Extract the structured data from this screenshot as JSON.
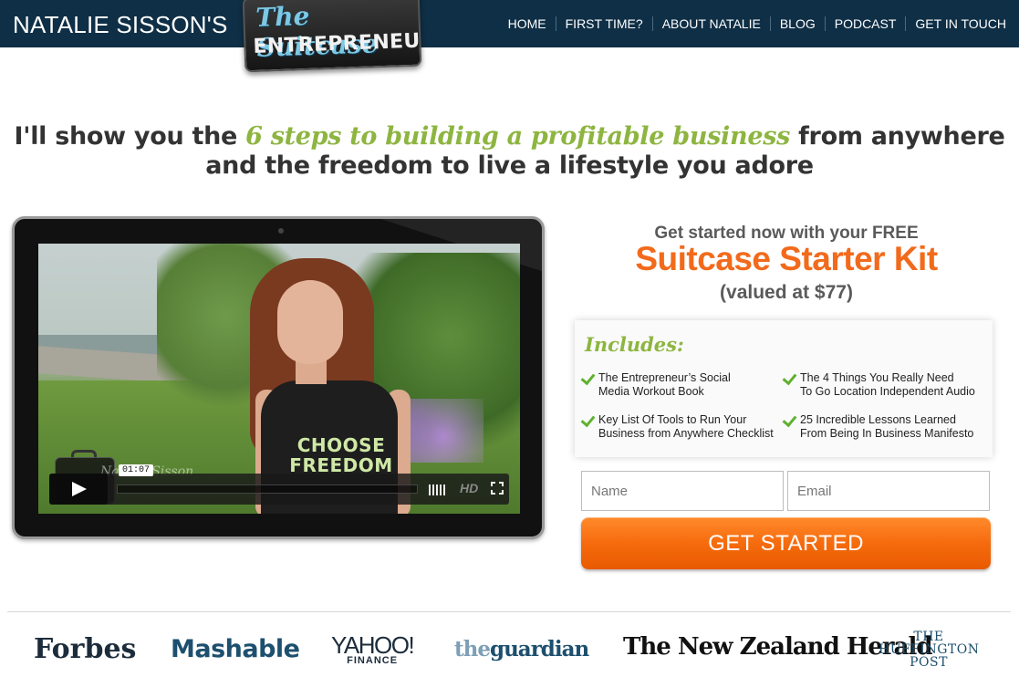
{
  "header": {
    "brand": "NATALIE SISSON'S",
    "logo_line1": "The Suitcase",
    "logo_line2": "ENTREPRENEUR",
    "nav": [
      "HOME",
      "FIRST TIME?",
      "ABOUT NATALIE",
      "BLOG",
      "PODCAST",
      "GET IN TOUCH"
    ]
  },
  "headline": {
    "before": "I'll show you the ",
    "accent": "6 steps to building a profitable business",
    "after": " from anywhere and the freedom to live a lifestyle you adore"
  },
  "video": {
    "timecode": "01:07",
    "shirt_line1": "CHOOSE",
    "shirt_line2": "FREEDOM",
    "watermark": "Natalie Sisson",
    "hd_label": "HD"
  },
  "offer": {
    "subtitle": "Get started now with your FREE",
    "title": "Suitcase Starter Kit",
    "value": "(valued at $77)",
    "includes_title": "Includes:",
    "items": [
      {
        "line1": "The Entrepreneur’s Social",
        "line2": "Media Workout Book"
      },
      {
        "line1": "The 4 Things You Really Need",
        "line2": "To Go Location Independent Audio"
      },
      {
        "line1": "Key List Of Tools to Run Your",
        "line2": "Business from Anywhere Checklist"
      },
      {
        "line1": "25 Incredible Lessons Learned",
        "line2": "From Being In Business Manifesto"
      }
    ]
  },
  "form": {
    "name_placeholder": "Name",
    "email_placeholder": "Email",
    "submit_label": "GET STARTED"
  },
  "press": {
    "forbes": "Forbes",
    "mashable": "Mashable",
    "yahoo_line1": "YAHOO!",
    "yahoo_line2": "FINANCE",
    "guardian_the": "the",
    "guardian_name": "guardian",
    "nzherald": "The New Zealand Herald",
    "huff_line1": "THE",
    "huff_line2": "HUFFINGTON",
    "huff_line3": "POST"
  },
  "colors": {
    "header_bg": "#0f2f46",
    "accent_green": "#8db540",
    "offer_orange": "#f26a1b"
  }
}
